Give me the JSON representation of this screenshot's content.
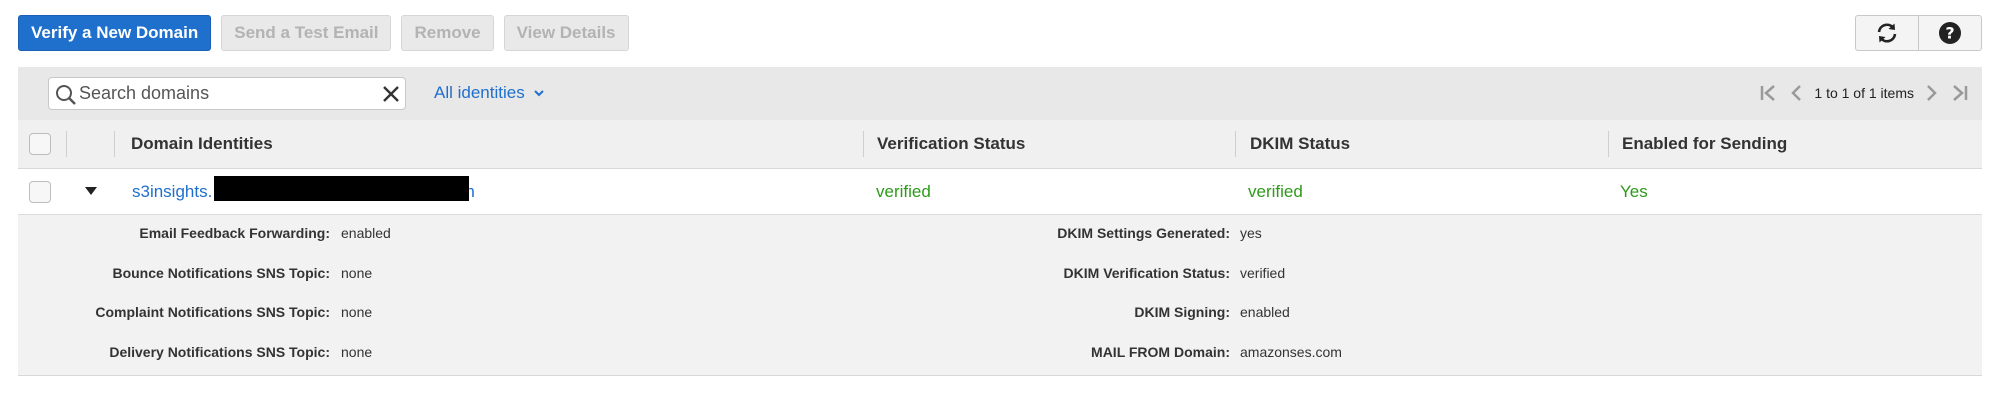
{
  "toolbar": {
    "verify_label": "Verify a New Domain",
    "test_email_label": "Send a Test Email",
    "remove_label": "Remove",
    "view_details_label": "View Details"
  },
  "filter": {
    "search_placeholder": "Search domains",
    "identity_filter": "All identities",
    "pager_text": "1 to 1 of 1 items"
  },
  "table": {
    "headers": {
      "domain": "Domain Identities",
      "verification": "Verification Status",
      "dkim": "DKIM Status",
      "enabled": "Enabled for Sending"
    },
    "row": {
      "domain_prefix": "s3insights.",
      "domain_suffix": "n",
      "verification": "verified",
      "dkim": "verified",
      "enabled": "Yes"
    }
  },
  "details": {
    "left": [
      {
        "label": "Email Feedback Forwarding:",
        "value": "enabled"
      },
      {
        "label": "Bounce Notifications SNS Topic:",
        "value": "none"
      },
      {
        "label": "Complaint Notifications SNS Topic:",
        "value": "none"
      },
      {
        "label": "Delivery Notifications SNS Topic:",
        "value": "none"
      }
    ],
    "right": [
      {
        "label": "DKIM Settings Generated:",
        "value": "yes"
      },
      {
        "label": "DKIM Verification Status:",
        "value": "verified"
      },
      {
        "label": "DKIM Signing:",
        "value": "enabled"
      },
      {
        "label": "MAIL FROM Domain:",
        "value": "amazonses.com"
      }
    ]
  },
  "icons": {
    "refresh": "refresh-icon",
    "help": "help-icon",
    "search": "search-icon",
    "clear": "close-icon",
    "expand": "caret-down-icon"
  },
  "colors": {
    "primary": "#1f6fcd",
    "success": "#2e9a1a"
  }
}
